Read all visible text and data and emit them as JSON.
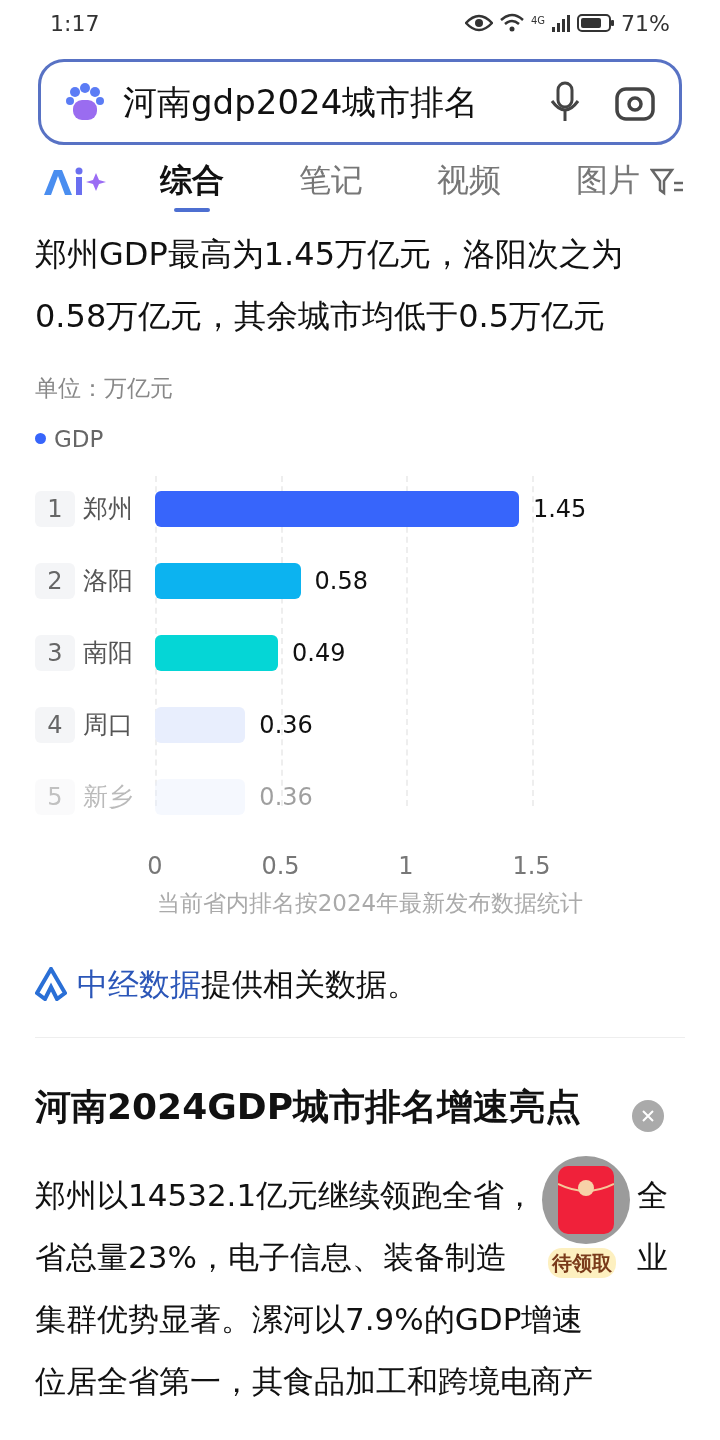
{
  "status_bar": {
    "time": "1:17",
    "battery": "71%",
    "network": "4G"
  },
  "search": {
    "query": "河南gdp2024城市排名"
  },
  "tabs": [
    {
      "label": "综合",
      "selected": true
    },
    {
      "label": "笔记",
      "selected": false
    },
    {
      "label": "视频",
      "selected": false
    },
    {
      "label": "图片",
      "selected": false
    }
  ],
  "summary": "郑州GDP最高为1.45万亿元，洛阳次之为0.58万亿元，其余城市均低于0.5万亿元",
  "chart": {
    "unit": "单位：万亿元",
    "bars": [
      {
        "rank": "1",
        "color": "#3765fb",
        "faded": false
      },
      {
        "rank": "2",
        "color": "#0cb3f0",
        "faded": false
      },
      {
        "rank": "3",
        "color": "#05d6d6",
        "faded": false
      },
      {
        "rank": "4",
        "color": "#e8eefd",
        "faded": false
      },
      {
        "rank": "5",
        "color": "#e8eefd",
        "faded": true
      }
    ],
    "chart_data": {
      "type": "bar",
      "orientation": "horizontal",
      "categories": [
        "郑州",
        "洛阳",
        "南阳",
        "周口",
        "新乡"
      ],
      "series": [
        {
          "name": "GDP",
          "values": [
            1.45,
            0.58,
            0.49,
            0.36,
            0.36
          ]
        }
      ],
      "value_labels": [
        "1.45",
        "0.58",
        "0.49",
        "0.36",
        "0.36"
      ],
      "xlim": [
        0,
        1.5
      ],
      "xticks": [
        0,
        {
          "value": 0.5,
          "label": "0.5"
        },
        1,
        {
          "value": 1.5,
          "label": "1.5"
        }
      ]
    },
    "note": "当前省内排名按2024年最新发布数据统计"
  },
  "source": {
    "link": "中经数据",
    "text": "提供相关数据。"
  },
  "section_title": "河南2024GDP城市排名增速亮点",
  "paragraph_lines": [
    {
      "left": "郑州以14532.1亿元继续领跑全省，",
      "right": "全"
    },
    {
      "left": "省总量23%，电子信息、装备制造",
      "right": "业"
    },
    {
      "left": "集群优势显著。漯河以7.9%的GDP增速"
    },
    {
      "left": "位居全省第一，其食品加工和跨境电商产"
    }
  ],
  "red_packet": {
    "label": "待领取"
  }
}
